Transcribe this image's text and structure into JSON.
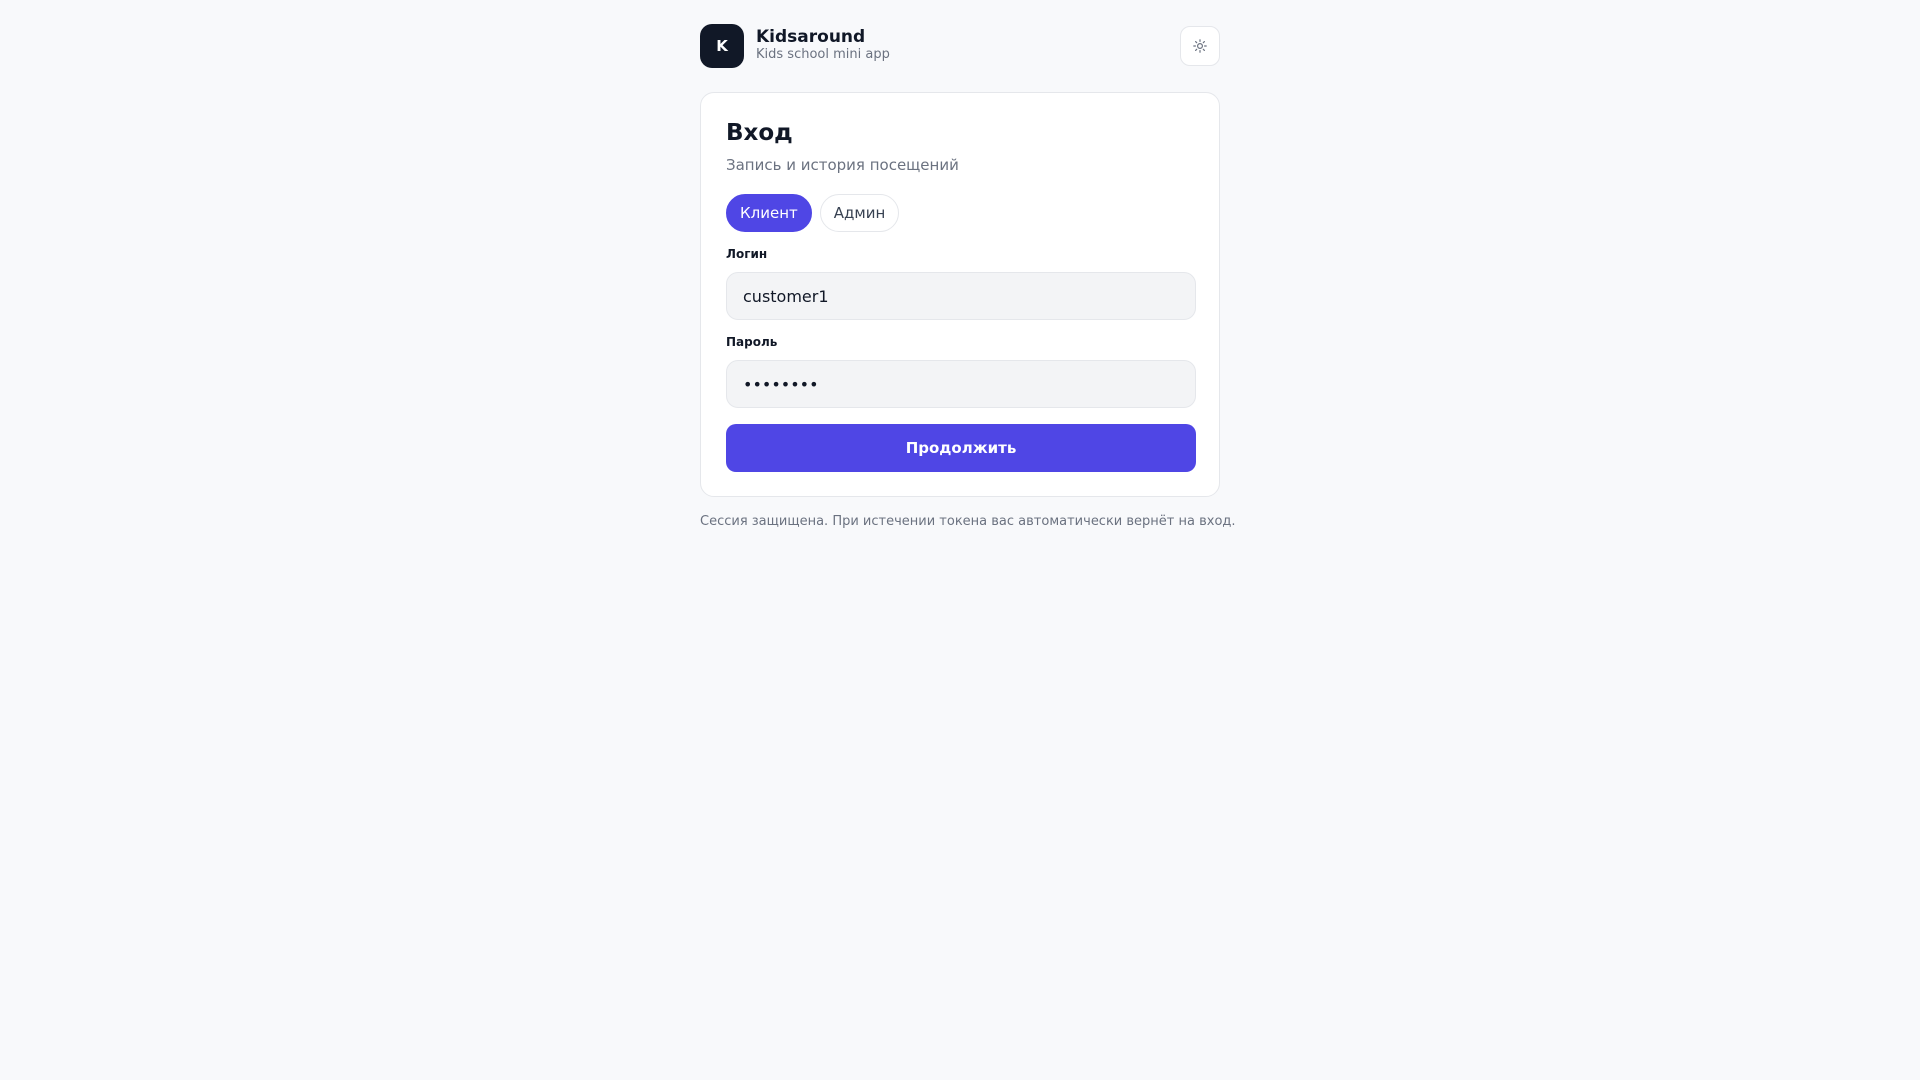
{
  "header": {
    "logo_letter": "K",
    "app_name": "Kidsaround",
    "app_subtitle": "Kids school mini app",
    "theme_toggle_icon": "sun-icon"
  },
  "login": {
    "title": "Вход",
    "subtitle": "Запись и история посещений",
    "tabs": [
      {
        "label": "Клиент",
        "active": true
      },
      {
        "label": "Админ",
        "active": false
      }
    ],
    "login_label": "Логин",
    "login_value": "customer1",
    "password_label": "Пароль",
    "password_value": "password",
    "submit_label": "Продолжить"
  },
  "footer_note": "Сессия защищена. При истечении токена вас автоматически вернёт на вход.",
  "colors": {
    "accent": "#4f46e5",
    "logo_bg": "#111827",
    "page_bg": "#f8f9fb"
  }
}
